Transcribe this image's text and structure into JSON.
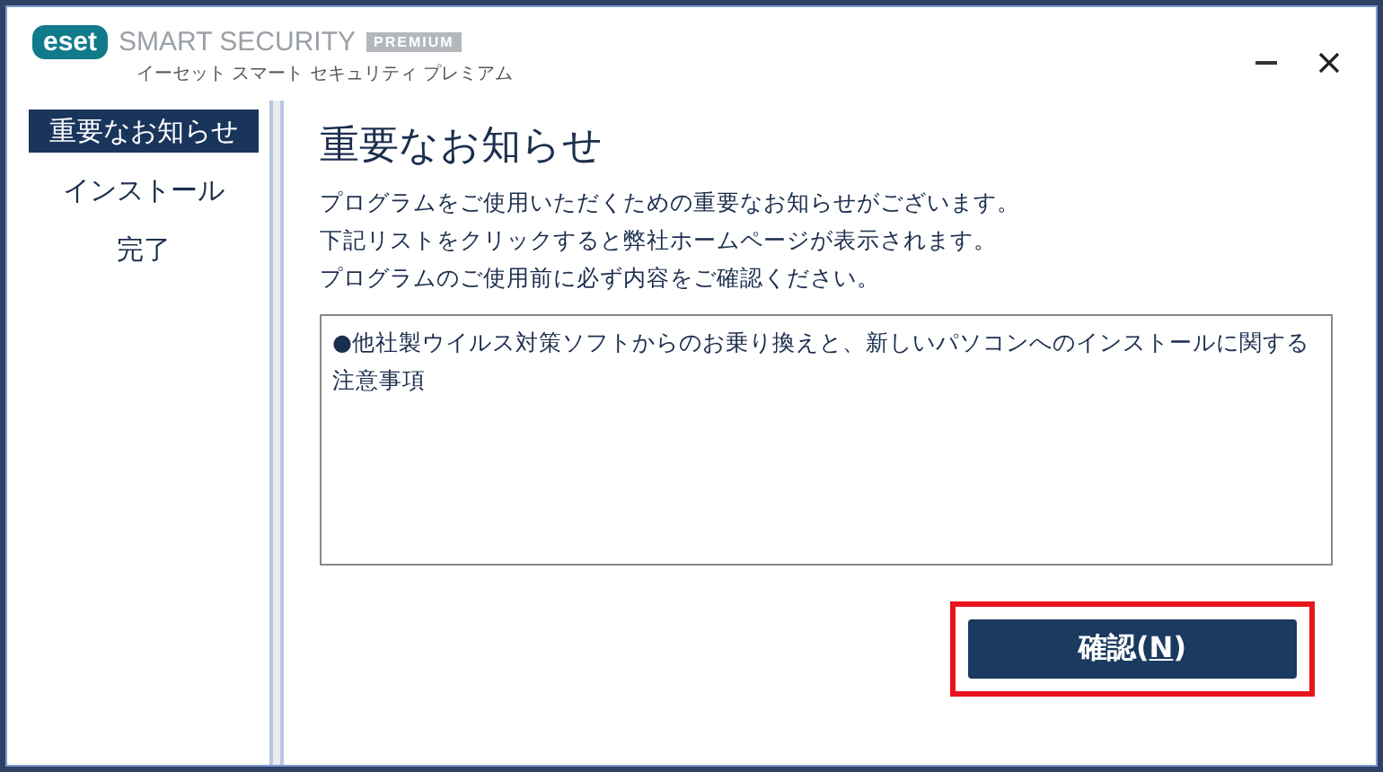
{
  "header": {
    "brand": "eset",
    "product": "SMART SECURITY",
    "edition": "PREMIUM",
    "subtitle": "イーセット スマート セキュリティ プレミアム"
  },
  "sidebar": {
    "items": [
      {
        "label": "重要なお知らせ",
        "selected": true
      },
      {
        "label": "インストール",
        "selected": false
      },
      {
        "label": "完了",
        "selected": false
      }
    ]
  },
  "content": {
    "title": "重要なお知らせ",
    "lines": [
      "プログラムをご使用いただくための重要なお知らせがございます。",
      "下記リストをクリックすると弊社ホームページが表示されます。",
      "プログラムのご使用前に必ず内容をご確認ください。"
    ],
    "notices": [
      "●他社製ウイルス対策ソフトからのお乗り換えと、新しいパソコンへのインストールに関する注意事項"
    ]
  },
  "confirm_button": {
    "label_before": "確認(",
    "access_key": "N",
    "label_after": ")",
    "highlighted": true
  }
}
